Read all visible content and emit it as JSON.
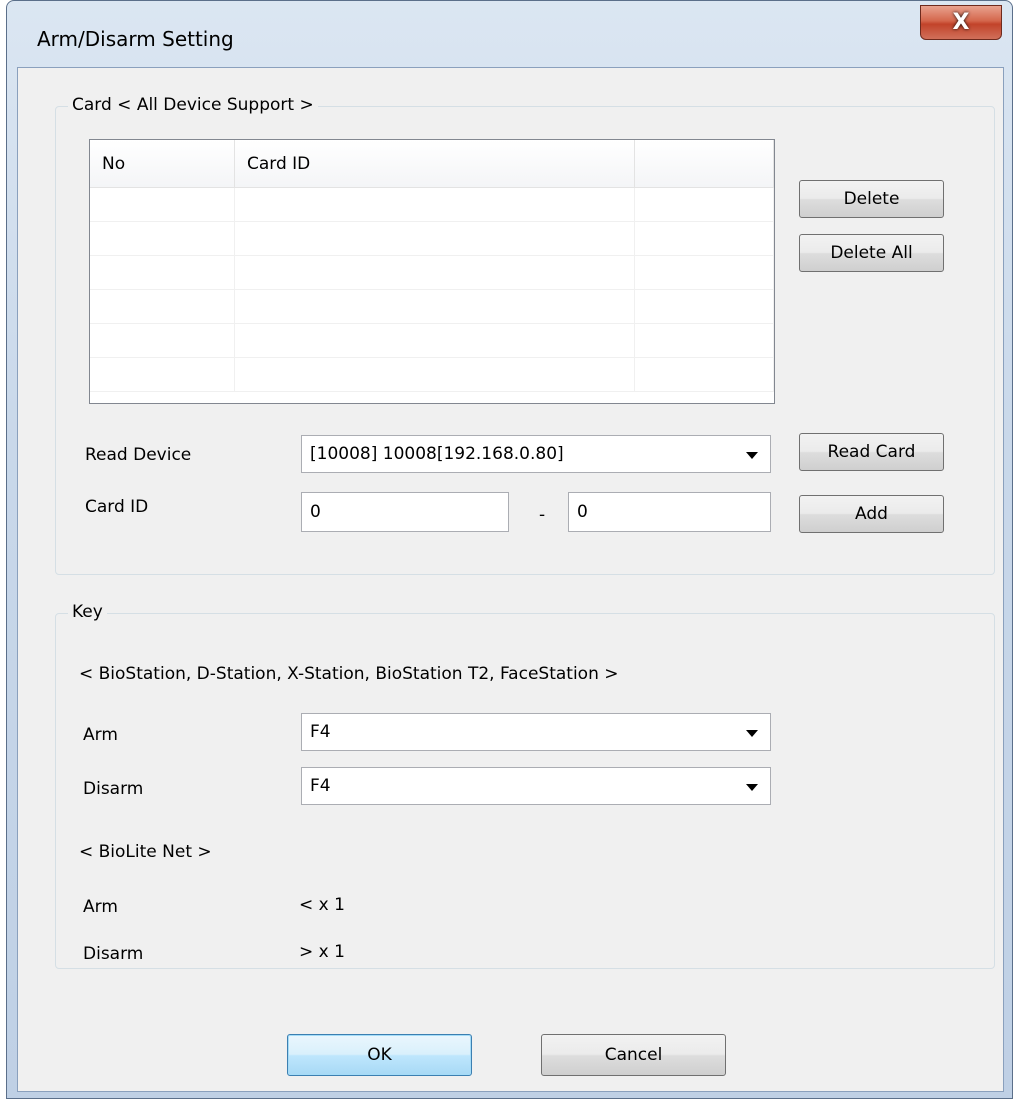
{
  "window": {
    "title": "Arm/Disarm Setting",
    "close_glyph": "X"
  },
  "card_group": {
    "legend": "Card < All Device Support >",
    "list": {
      "columns": [
        "No",
        "Card ID",
        ""
      ],
      "rows": []
    },
    "delete_label": "Delete",
    "delete_all_label": "Delete All",
    "read_device_label": "Read Device",
    "read_device_value": "[10008] 10008[192.168.0.80]",
    "read_card_label": "Read Card",
    "card_id_label": "Card ID",
    "card_id_from": "0",
    "range_separator": "-",
    "card_id_to": "0",
    "add_label": "Add"
  },
  "key_group": {
    "legend": "Key",
    "stations_caption": "< BioStation, D-Station, X-Station, BioStation T2, FaceStation >",
    "arm_label": "Arm",
    "arm_value": "F4",
    "disarm_label": "Disarm",
    "disarm_value": "F4",
    "biolite_caption": "< BioLite Net >",
    "biolite_arm_label": "Arm",
    "biolite_arm_value": "< x 1",
    "biolite_disarm_label": "Disarm",
    "biolite_disarm_value": "> x 1"
  },
  "footer": {
    "ok_label": "OK",
    "cancel_label": "Cancel"
  }
}
